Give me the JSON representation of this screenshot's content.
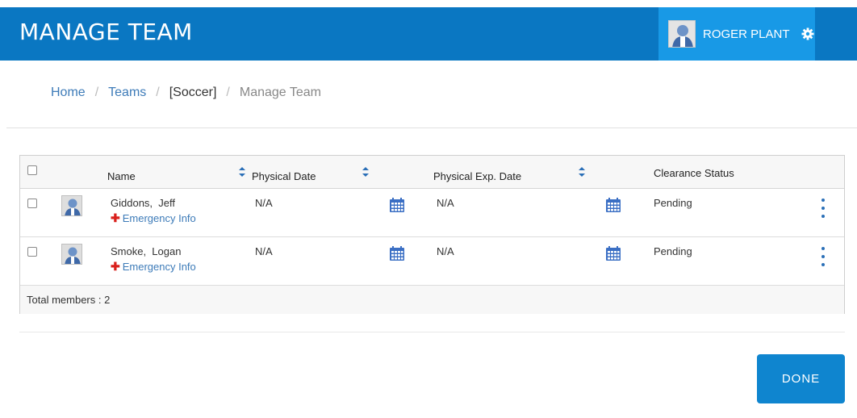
{
  "header": {
    "title": "MANAGE TEAM",
    "user_name": "ROGER PLANT",
    "settings_icon": "gear-icon",
    "brand_color": "#0a77c2",
    "user_box_color": "#1899e6"
  },
  "breadcrumb": {
    "items": [
      {
        "label": "Home",
        "type": "link"
      },
      {
        "label": "Teams",
        "type": "link"
      },
      {
        "label": "[Soccer]",
        "type": "plain"
      },
      {
        "label": "Manage Team",
        "type": "active"
      }
    ],
    "separator": "/"
  },
  "table": {
    "columns": {
      "name": "Name",
      "physical_date": "Physical Date",
      "physical_exp_date": "Physical Exp. Date",
      "clearance_status": "Clearance Status"
    },
    "rows": [
      {
        "name": "Giddons,  Jeff",
        "emergency_label": "Emergency Info",
        "physical_date": "N/A",
        "physical_exp_date": "N/A",
        "clearance_status": "Pending"
      },
      {
        "name": "Smoke,  Logan",
        "emergency_label": "Emergency Info",
        "physical_date": "N/A",
        "physical_exp_date": "N/A",
        "clearance_status": "Pending"
      }
    ],
    "footer": "Total members : 2"
  },
  "actions": {
    "done_label": "DONE"
  }
}
